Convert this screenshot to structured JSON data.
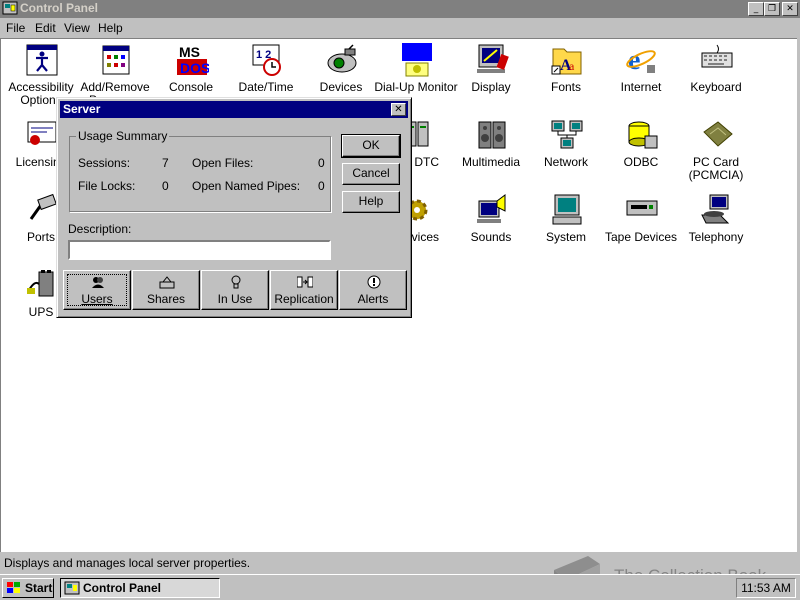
{
  "window": {
    "title": "Control Panel"
  },
  "menu": {
    "items": [
      "File",
      "Edit",
      "View",
      "Help"
    ]
  },
  "icons": [
    {
      "label": "Accessibility Options",
      "icon": "accessibility-icon"
    },
    {
      "label": "Add/Remove Programs",
      "icon": "add-remove-programs-icon"
    },
    {
      "label": "Console",
      "icon": "console-icon"
    },
    {
      "label": "Date/Time",
      "icon": "date-time-icon"
    },
    {
      "label": "Devices",
      "icon": "devices-icon"
    },
    {
      "label": "Dial-Up Monitor",
      "icon": "dialup-monitor-icon"
    },
    {
      "label": "Display",
      "icon": "display-icon"
    },
    {
      "label": "Fonts",
      "icon": "fonts-icon"
    },
    {
      "label": "Internet",
      "icon": "internet-icon"
    },
    {
      "label": "Keyboard",
      "icon": "keyboard-icon"
    },
    {
      "label": "Licensing",
      "icon": "licensing-icon"
    },
    {
      "label": "MS DTC",
      "icon": "msdtc-icon"
    },
    {
      "label": "Multimedia",
      "icon": "multimedia-icon"
    },
    {
      "label": "Network",
      "icon": "network-icon"
    },
    {
      "label": "ODBC",
      "icon": "odbc-icon"
    },
    {
      "label": "PC Card (PCMCIA)",
      "icon": "pc-card-icon"
    },
    {
      "label": "Ports",
      "icon": "ports-icon"
    },
    {
      "label": "Services",
      "icon": "services-icon"
    },
    {
      "label": "Sounds",
      "icon": "sounds-icon"
    },
    {
      "label": "System",
      "icon": "system-icon"
    },
    {
      "label": "Tape Devices",
      "icon": "tape-devices-icon"
    },
    {
      "label": "Telephony",
      "icon": "telephony-icon"
    },
    {
      "label": "UPS",
      "icon": "ups-icon"
    }
  ],
  "dialog": {
    "title": "Server",
    "group_title": "Usage Summary",
    "sessions_label": "Sessions:",
    "sessions_value": "7",
    "open_files_label": "Open Files:",
    "open_files_value": "0",
    "file_locks_label": "File Locks:",
    "file_locks_value": "0",
    "open_pipes_label": "Open Named Pipes:",
    "open_pipes_value": "0",
    "ok": "OK",
    "cancel": "Cancel",
    "help": "Help",
    "description_label": "Description:",
    "description_value": "",
    "buttons": [
      "Users",
      "Shares",
      "In Use",
      "Replication",
      "Alerts"
    ]
  },
  "status": {
    "text": "Displays and manages local server properties."
  },
  "taskbar": {
    "start": "Start",
    "task": "Control Panel",
    "clock": "11:53 AM"
  },
  "watermark": {
    "text": "The Collection Book"
  }
}
